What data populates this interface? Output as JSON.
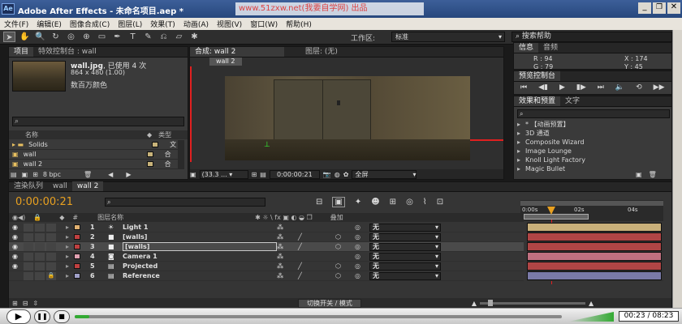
{
  "app": {
    "title": "Adobe After Effects - 未命名项目.aep *",
    "watermark": "www.51zxw.net(我要自学网) 出品",
    "logo": "Ae"
  },
  "menu": [
    "文件(F)",
    "编辑(E)",
    "图像合成(C)",
    "图层(L)",
    "效果(T)",
    "动画(A)",
    "视图(V)",
    "窗口(W)",
    "帮助(H)"
  ],
  "toolbar": {
    "workspace_label": "工作区:",
    "workspace_value": "标准",
    "search_placeholder": "搜索帮助"
  },
  "project": {
    "tabs": [
      "项目",
      "特效控制台 : wall"
    ],
    "item_name": "wall.jpg",
    "item_used": ", 已使用 4 次",
    "item_dims": "864 x 480 (1.00)",
    "item_color": "数百万颜色",
    "search_value": "",
    "col_name": "名称",
    "col_type": "类型",
    "rows": [
      {
        "name": "Solids",
        "type": "文",
        "color": "#c8b37a"
      },
      {
        "name": "wall",
        "type": "合",
        "color": "#c8b37a"
      },
      {
        "name": "wall 2",
        "type": "合",
        "color": "#c8b37a"
      }
    ],
    "bpc": "8 bpc"
  },
  "comp": {
    "tab": "合成: wall 2",
    "layer_tab": "图层: (无)",
    "sub_tab": "wall 2",
    "zoom": "(33.3 ...",
    "timecode": "0:00:00:21",
    "view": "全屏"
  },
  "info": {
    "tabs": [
      "信息",
      "音频"
    ],
    "r": "R : 94",
    "g": "G : 79",
    "x": "X : 174",
    "y": "Y : 45"
  },
  "preview": {
    "title": "预览控制台"
  },
  "effects": {
    "tabs": [
      "效果和预置",
      "文字"
    ],
    "search": "",
    "items": [
      "* 【动画预置】",
      "3D 通道",
      "Composite Wizard",
      "Image Lounge",
      "Knoll Light Factory",
      "Magic Bullet"
    ]
  },
  "timeline": {
    "tabs": [
      "渲染队列",
      "wall",
      "wall 2"
    ],
    "timecode": "0:00:00:21",
    "col_num": "#",
    "col_name": "图层名称",
    "col_mode": "叠加",
    "col_mode_opt": "无",
    "ruler": [
      "0:00s",
      "02s",
      "04s"
    ],
    "layers": [
      {
        "num": "1",
        "name": "Light 1",
        "color": "#e0b070",
        "bar": "#c9b07a",
        "icon": "light"
      },
      {
        "num": "2",
        "name": "[walls]",
        "color": "#c04040",
        "bar": "#b04545",
        "icon": "solid"
      },
      {
        "num": "3",
        "name": "[walls]",
        "color": "#c04040",
        "bar": "#b04545",
        "icon": "solid"
      },
      {
        "num": "4",
        "name": "Camera 1",
        "color": "#e0a0b0",
        "bar": "#c07080",
        "icon": "camera"
      },
      {
        "num": "5",
        "name": "Projected",
        "color": "#c04040",
        "bar": "#b04545",
        "icon": "comp"
      },
      {
        "num": "6",
        "name": "Reference",
        "color": "#a0a0c8",
        "bar": "#7a7aa8",
        "icon": "comp"
      }
    ],
    "switch_label": "切换开关 / 模式"
  },
  "player": {
    "time": "00:23 / 08:23"
  }
}
